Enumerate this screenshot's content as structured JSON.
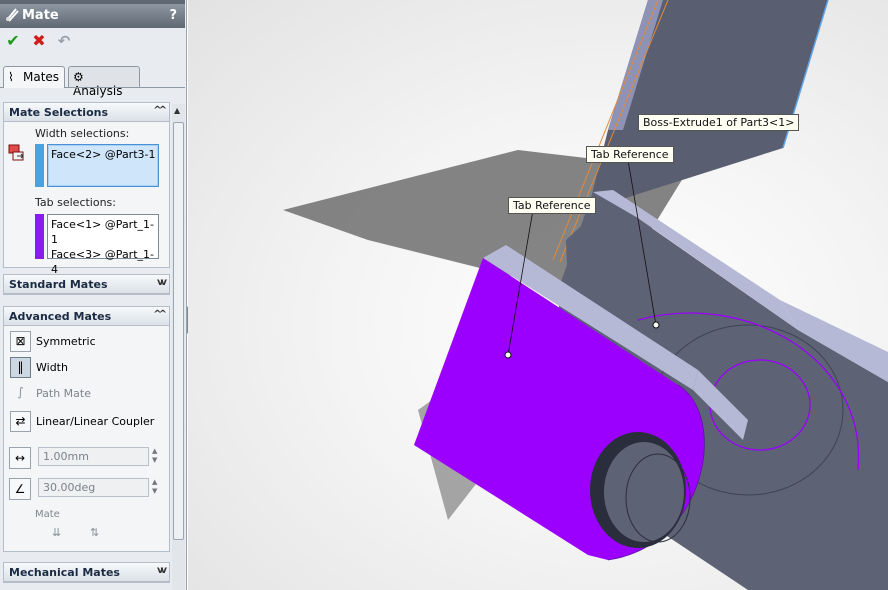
{
  "title": "Mate",
  "help": "?",
  "tabs": {
    "mates": "Mates",
    "analysis": "Analysis"
  },
  "mate_selections": {
    "header": "Mate Selections",
    "width_label": "Width selections:",
    "width_items": [
      "Face<2> @Part3-1"
    ],
    "tab_label": "Tab selections:",
    "tab_items": [
      "Face<1> @Part_1-1",
      "Face<3> @Part_1-4"
    ],
    "colors": {
      "width": "#4aa3e0",
      "tab": "#8a1cf0"
    }
  },
  "standard_mates": {
    "header": "Standard Mates"
  },
  "advanced_mates": {
    "header": "Advanced Mates",
    "items": [
      {
        "label": "Symmetric",
        "icon": "symmetric-icon",
        "enabled": true
      },
      {
        "label": "Width",
        "icon": "width-icon",
        "enabled": true,
        "selected": true
      },
      {
        "label": "Path Mate",
        "icon": "path-mate-icon",
        "enabled": false
      },
      {
        "label": "Linear/Linear Coupler",
        "icon": "linear-coupler-icon",
        "enabled": true
      }
    ],
    "distance": "1.00mm",
    "angle": "30.00deg",
    "mate_alignment_label": "Mate"
  },
  "mechanical_mates": {
    "header": "Mechanical Mates"
  },
  "viewport": {
    "callouts": {
      "boss": "Boss-Extrude1 of Part3<1>",
      "tab_ref_1": "Tab Reference",
      "tab_ref_2": "Tab Reference"
    },
    "colors": {
      "face_highlight": "#9b00ff",
      "part_body": "#5d6275",
      "part_light": "#b6b9d6"
    }
  }
}
